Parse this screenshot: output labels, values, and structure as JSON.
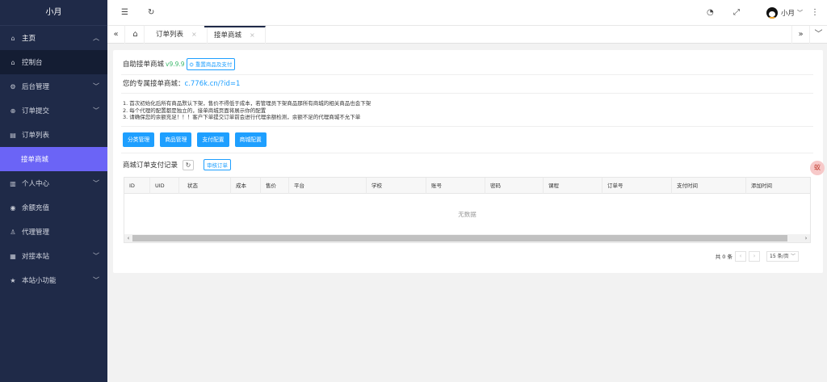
{
  "sidebar": {
    "brand": "小月",
    "items": [
      {
        "name": "home",
        "label": "主页",
        "icon": "home-icon",
        "glyph": "⌂",
        "chevron": "up"
      },
      {
        "name": "dashboard",
        "label": "控制台",
        "icon": "home-outline-icon",
        "glyph": "⌂"
      },
      {
        "name": "admin",
        "label": "后台管理",
        "icon": "gear-icon",
        "glyph": "⚙",
        "chevron": "down"
      },
      {
        "name": "order-submit",
        "label": "订单提交",
        "icon": "plus-circle-icon",
        "glyph": "⊕",
        "chevron": "down"
      },
      {
        "name": "order-list",
        "label": "订单列表",
        "icon": "document-icon",
        "glyph": "▤"
      },
      {
        "name": "order-mall",
        "label": "接单商城",
        "icon": "",
        "glyph": ""
      },
      {
        "name": "personal",
        "label": "个人中心",
        "icon": "list-icon",
        "glyph": "▥",
        "chevron": "down"
      },
      {
        "name": "recharge",
        "label": "余额充值",
        "icon": "coin-icon",
        "glyph": "◉"
      },
      {
        "name": "agent",
        "label": "代理管理",
        "icon": "user-icon",
        "glyph": "♙"
      },
      {
        "name": "dock",
        "label": "对接本站",
        "icon": "grid-icon",
        "glyph": "▦",
        "chevron": "down"
      },
      {
        "name": "tools",
        "label": "本站小功能",
        "icon": "star-icon",
        "glyph": "★",
        "chevron": "down"
      }
    ]
  },
  "header": {
    "user_name": "小月",
    "icons": [
      "menu-collapse-icon",
      "refresh-icon",
      "theme-icon",
      "fullscreen-icon",
      "more-icon"
    ]
  },
  "tabs": {
    "items": [
      {
        "label": "订单列表",
        "close": "×"
      },
      {
        "label": "接单商城",
        "close": "×"
      }
    ]
  },
  "main": {
    "title": "自助接单商城",
    "version": "v9.9.9",
    "reset_button": "⛭ 重置商品及支付",
    "shop_link_label": "您的专属接单商城：",
    "shop_link_url": "c.776k.cn/?id=1",
    "notes": [
      "1. 首次初始化后所有商品默认下架，售价不得低于成本，若管理员下架商品那所有商城的相关商品也会下架",
      "2. 每个代理的配置都是独立的，接单商城页面将展示你的配置",
      "3. 请确保您的余额充足！！！客户下单提交订单前会进行代理余额检测，余额不足的代理商城不允下单"
    ],
    "buttons": [
      "分类管理",
      "商品管理",
      "支付配置",
      "商城配置"
    ],
    "records_title": "商城订单支付记录",
    "audit_button": "审核订单",
    "table": {
      "columns": [
        "ID",
        "UID",
        "状态",
        "成本",
        "售价",
        "平台",
        "学校",
        "账号",
        "密码",
        "课程",
        "订单号",
        "支付时间",
        "添加时间"
      ],
      "empty_text": "无数据"
    },
    "pager": {
      "total": "共 0 条",
      "prev": "‹",
      "next": "›",
      "page_size": "15 条/页"
    }
  },
  "float_badge": "蚁"
}
